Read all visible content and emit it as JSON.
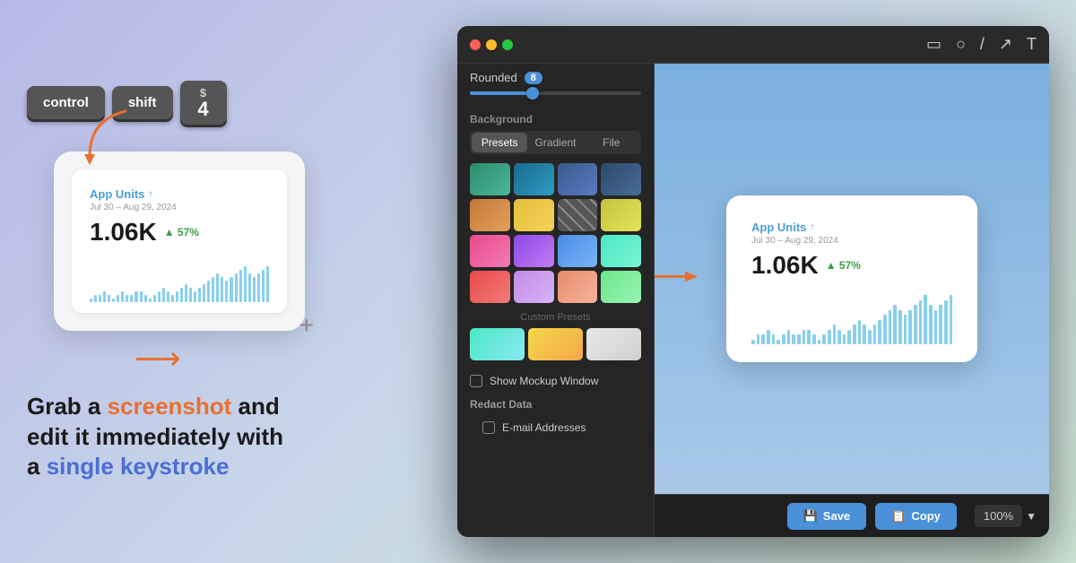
{
  "keyboard": {
    "key1": "control",
    "key2": "shift",
    "dollar_sign": "$",
    "dollar_num": "4"
  },
  "screenshot_card": {
    "title": "App Units",
    "arrow_up": "↑",
    "date": "Jul 30 – Aug 29, 2024",
    "value": "1.06K",
    "change": "▲ 57%"
  },
  "cta": {
    "line1_prefix": "Grab a ",
    "line1_highlight": "screenshot",
    "line1_suffix": " and",
    "line2": "edit it immediately with",
    "line3_prefix": "a ",
    "line3_highlight": "single keystroke"
  },
  "app": {
    "sidebar": {
      "rounded_label": "Rounded",
      "rounded_value": "8",
      "background_label": "Background",
      "tab_presets": "Presets",
      "tab_gradient": "Gradient",
      "tab_file": "File",
      "custom_presets": "Custom Presets",
      "show_mockup_label": "Show Mockup Window",
      "redact_label": "Redact Data",
      "email_label": "E-mail Addresses"
    },
    "toolbar_icons": [
      "▭",
      "○",
      "/",
      "↗",
      "T"
    ],
    "preview": {
      "title": "App Units",
      "arrow": "↑",
      "date": "Jul 30 – Aug 29, 2024",
      "value": "1.06K",
      "change": "▲ 57%"
    },
    "footer": {
      "save_label": "Save",
      "copy_label": "Copy",
      "zoom": "100%"
    }
  },
  "bars": [
    1,
    2,
    2,
    3,
    2,
    1,
    2,
    3,
    2,
    2,
    3,
    3,
    2,
    1,
    2,
    3,
    4,
    3,
    2,
    3,
    4,
    5,
    4,
    3,
    4,
    5,
    6,
    7,
    8,
    7,
    6,
    7,
    8,
    9,
    10,
    8,
    7,
    8,
    9,
    10
  ]
}
